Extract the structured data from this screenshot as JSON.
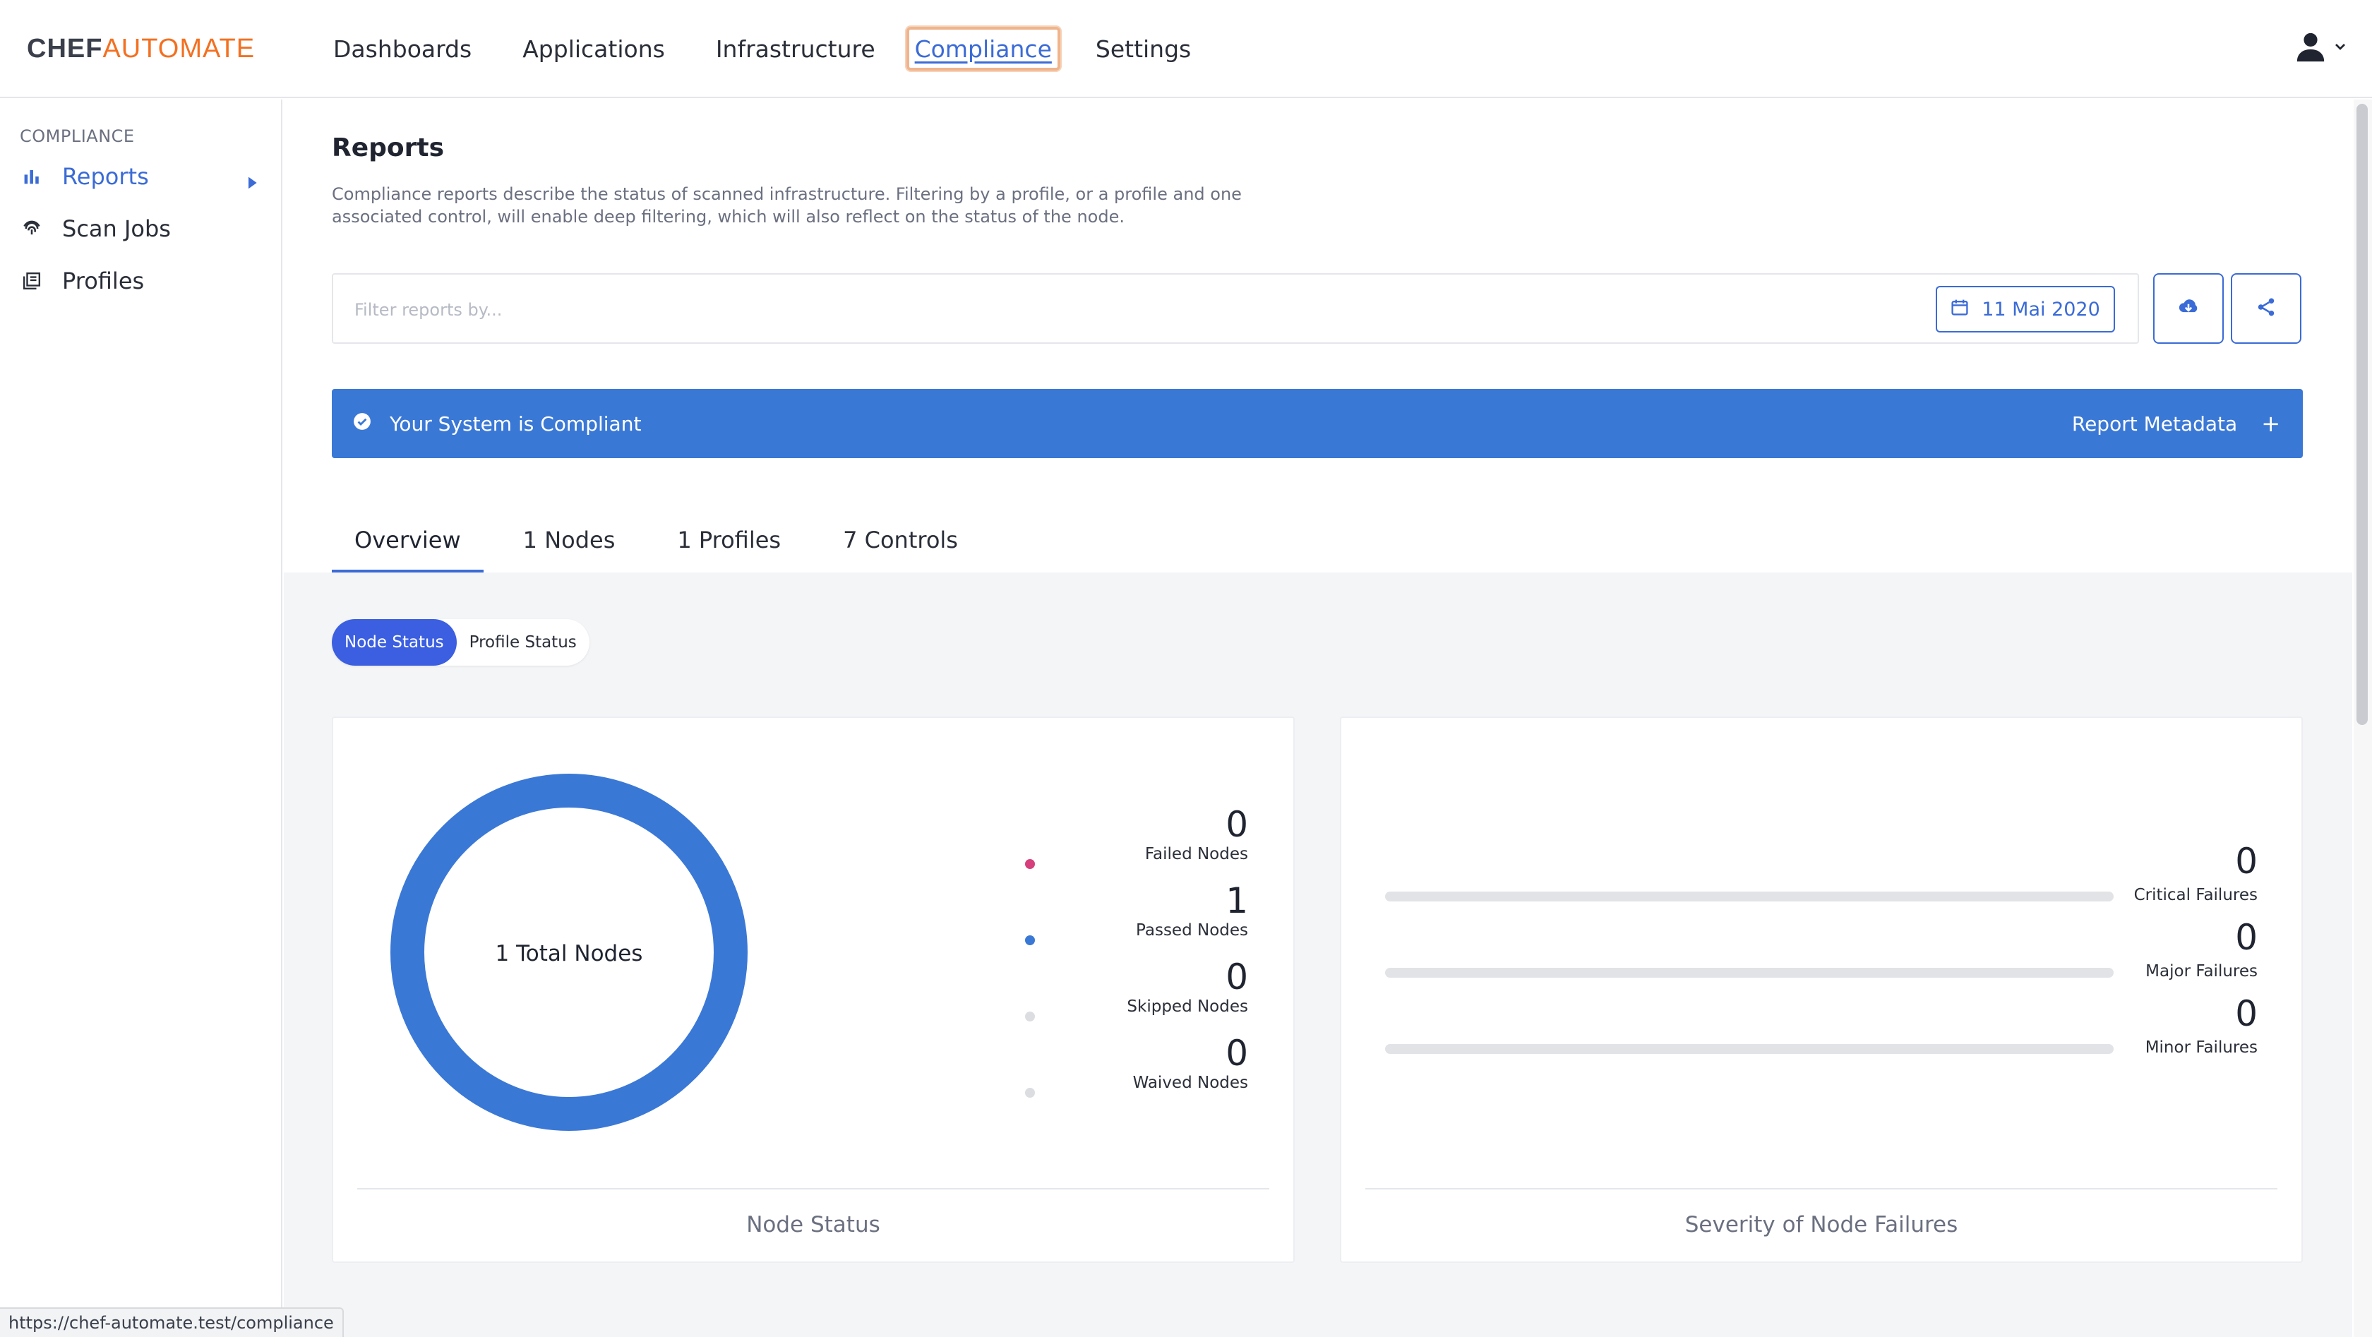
{
  "brand": {
    "chef": "CHEF",
    "automate": "AUTOMATE",
    "accent": "#f37021"
  },
  "nav": {
    "items": [
      "Dashboards",
      "Applications",
      "Infrastructure",
      "Compliance",
      "Settings"
    ],
    "active": "Compliance",
    "user_icon": "user-icon"
  },
  "sidebar": {
    "section": "COMPLIANCE",
    "items": [
      {
        "label": "Reports",
        "icon": "bar-chart-icon",
        "active": true
      },
      {
        "label": "Scan Jobs",
        "icon": "fingerprint-icon",
        "active": false
      },
      {
        "label": "Profiles",
        "icon": "library-icon",
        "active": false
      }
    ]
  },
  "page": {
    "title": "Reports",
    "description": "Compliance reports describe the status of scanned infrastructure. Filtering by a profile, or a profile and one associated control, will enable deep filtering, which will also reflect on the status of the node."
  },
  "filter": {
    "placeholder": "Filter reports by...",
    "date": "11 Mai 2020"
  },
  "actions": {
    "download_icon": "cloud-download-icon",
    "share_icon": "share-icon"
  },
  "banner": {
    "message": "Your System is Compliant",
    "metadata_label": "Report Metadata",
    "plus": "+",
    "color": "#3a78d6"
  },
  "tabs": [
    "Overview",
    "1 Nodes",
    "1 Profiles",
    "7 Controls"
  ],
  "active_tab": "Overview",
  "toggle": {
    "options": [
      "Node Status",
      "Profile Status"
    ],
    "selected": "Node Status"
  },
  "node_status": {
    "center_label": "1 Total Nodes",
    "title": "Node Status",
    "legend": [
      {
        "count": "0",
        "label": "Failed Nodes",
        "color": "#d63f7c"
      },
      {
        "count": "1",
        "label": "Passed Nodes",
        "color": "#3a78d6"
      },
      {
        "count": "0",
        "label": "Skipped Nodes",
        "color": "#dcdde0"
      },
      {
        "count": "0",
        "label": "Waived Nodes",
        "color": "#dcdde0"
      }
    ]
  },
  "severity": {
    "title": "Severity of Node Failures",
    "rows": [
      {
        "count": "0",
        "label": "Critical Failures"
      },
      {
        "count": "0",
        "label": "Major Failures"
      },
      {
        "count": "0",
        "label": "Minor Failures"
      }
    ]
  },
  "status_url": "https://chef-automate.test/compliance"
}
